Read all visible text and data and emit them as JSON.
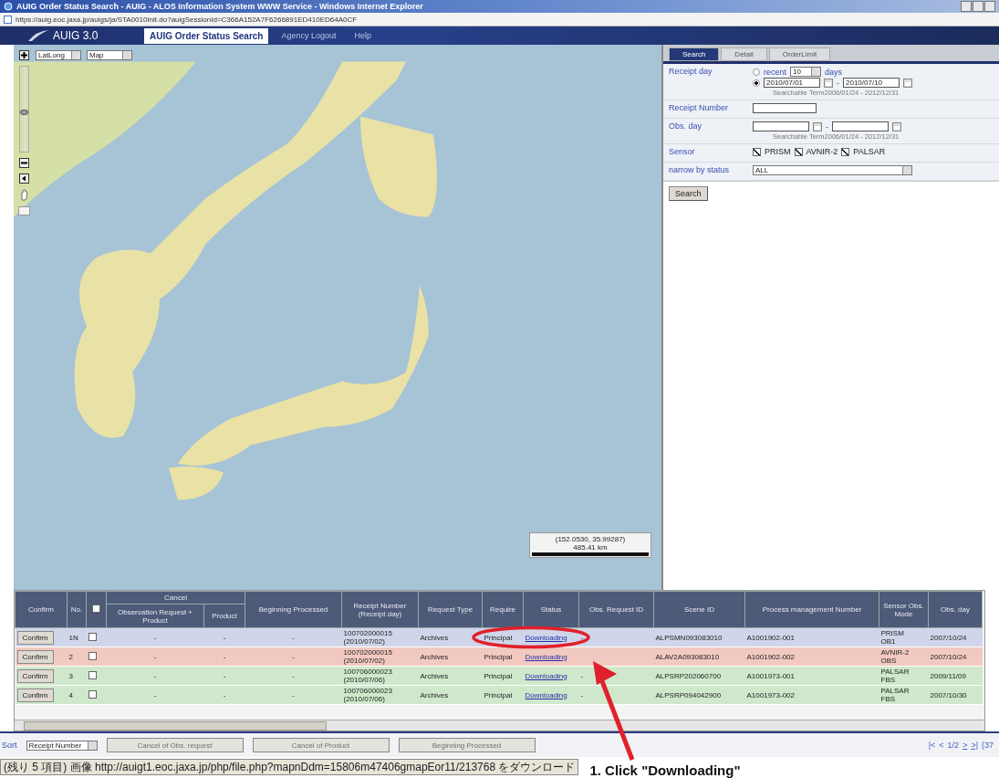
{
  "window": {
    "title": "AUIG Order Status Search - AUIG - ALOS Information System WWW Service - Windows Internet Explorer"
  },
  "address_bar": {
    "url": "https://auig.eoc.jaxa.jp/auigs/ja/STA0010Init.do?auigSessionId=C366A152A7F6266891ED410ED64A0CF"
  },
  "nav": {
    "logo": "AUIG 3.0",
    "tabs": [
      {
        "label": "AUIG Order Status Search",
        "selected": true
      },
      {
        "label": "Agency Logout",
        "selected": false
      },
      {
        "label": "Help",
        "selected": false
      }
    ]
  },
  "map": {
    "zoom": {
      "level": 0.45
    },
    "projection_select": "LatLong",
    "layer_select": "Map",
    "coordinates": "(152.0530, 35.99287)",
    "scale": "485.41 km"
  },
  "search_panel": {
    "tabs": [
      {
        "label": "Search",
        "selected": true
      },
      {
        "label": "Detail",
        "selected": false
      },
      {
        "label": "OrderLimit",
        "selected": false
      }
    ],
    "receipt_day": {
      "label": "Receipt day",
      "recent": {
        "selected": false,
        "label": "recent",
        "value": "10",
        "unit": "days"
      },
      "range": {
        "selected": true,
        "from": "2010/07/01",
        "separator": "-",
        "to": "2010/07/10"
      },
      "note": "Searchable Term2006/01/24 - 2012/12/31"
    },
    "receipt_number": {
      "label": "Receipt Number"
    },
    "obs_day": {
      "label": "Obs. day",
      "separator": "-",
      "note": "Searchable Term2006/01/24 - 2012/12/31"
    },
    "sensor": {
      "label": "Sensor",
      "options": [
        {
          "label": "PRISM",
          "checked": true
        },
        {
          "label": "AVNIR-2",
          "checked": true
        },
        {
          "label": "PALSAR",
          "checked": true
        }
      ]
    },
    "status_filter": {
      "label": "narrow by status",
      "value": "ALL"
    },
    "search_button": "Search"
  },
  "table": {
    "columns": [
      {
        "kind": "text",
        "label": "Confirm"
      },
      {
        "kind": "text",
        "label": "No."
      },
      {
        "kind": "checkbox",
        "checked": false
      },
      {
        "kind": "group",
        "label": "Cancel",
        "children": [
          {
            "label": "Observation Request + Product"
          },
          {
            "label": "Product"
          }
        ]
      },
      {
        "kind": "text",
        "label": "Beginning Processed"
      },
      {
        "kind": "text",
        "label": "Receipt Number (Receipt day)"
      },
      {
        "kind": "text",
        "label": "Request Type"
      },
      {
        "kind": "text",
        "label": "Require"
      },
      {
        "kind": "text",
        "label": "Status"
      },
      {
        "kind": "text",
        "label": "Obs. Request ID"
      },
      {
        "kind": "text",
        "label": "Scene ID"
      },
      {
        "kind": "text",
        "label": "Process management Number"
      },
      {
        "kind": "text",
        "label": "Sensor Obs. Mode"
      },
      {
        "kind": "text",
        "label": "Obs. day"
      }
    ],
    "rows": [
      {
        "confirm": "Confirm",
        "no": "1N",
        "checked": false,
        "cancel_obs": "-",
        "cancel_product": "-",
        "beginning": "-",
        "receipt_number": "100702000015",
        "receipt_day": "(2010/07/02)",
        "request_type": "Archives",
        "require": "Principal",
        "status": "Downloading",
        "obs_request_id": "-",
        "scene_id": "ALPSMN093083010",
        "process_number": "A1001902-001",
        "sensor": "PRISM",
        "obs_mode": "OB1",
        "obs_day": "2007/10/24",
        "color": "#cfd6ea"
      },
      {
        "confirm": "Confirm",
        "no": "2",
        "checked": false,
        "cancel_obs": "-",
        "cancel_product": "-",
        "beginning": "-",
        "receipt_number": "100702000015",
        "receipt_day": "(2010/07/02)",
        "request_type": "Archives",
        "require": "Principal",
        "status": "Downloading",
        "scene_id": "ALAV2A093083010",
        "process_number": "A1001902-002",
        "sensor": "AVNIR-2",
        "obs_mode": "OBS",
        "obs_day": "2007/10/24",
        "color": "#f2c9c0"
      },
      {
        "confirm": "Confirm",
        "no": "3",
        "checked": false,
        "cancel_obs": "-",
        "cancel_product": "-",
        "beginning": "-",
        "receipt_number": "100706000023",
        "receipt_day": "(2010/07/06)",
        "request_type": "Archives",
        "require": "Principal",
        "status": "Downloading",
        "obs_request_id": "-",
        "scene_id": "ALPSRP202060700",
        "process_number": "A1001973-001",
        "sensor": "PALSAR",
        "obs_mode": "FBS",
        "obs_day": "2009/11/09",
        "color": "#cfe8cc"
      },
      {
        "confirm": "Confirm",
        "no": "4",
        "checked": false,
        "cancel_obs": "-",
        "cancel_product": "-",
        "beginning": "-",
        "receipt_number": "100706000023",
        "receipt_day": "(2010/07/06)",
        "request_type": "Archives",
        "require": "Principal",
        "status": "Downloading",
        "obs_request_id": "-",
        "scene_id": "ALPSRP094042900",
        "process_number": "A1001973-002",
        "sensor": "PALSAR",
        "obs_mode": "FBS",
        "obs_day": "2007/10/30",
        "color": "#cfe8cc"
      }
    ]
  },
  "bottom_bar": {
    "sort_label": "Sort",
    "sort_value": "Receipt Number",
    "buttons": [
      {
        "label": "Cancel of Obs. request",
        "disabled": true
      },
      {
        "label": "Cancel of Product",
        "disabled": true
      },
      {
        "label": "Beginning Processed",
        "disabled": true
      }
    ],
    "pager": {
      "first": "|<",
      "prev": "<",
      "page": "1/2",
      "next": ">",
      "last": ">|",
      "count": "(37"
    }
  },
  "status_bar": {
    "text": "(残り 5 項目) 画像 http://auigt1.eoc.jaxa.jp/php/file.php?mapnDdm=15806m47406gmapEor11/213768 をダウンロード"
  },
  "annotation": {
    "caption": "1. Click \"Downloading\""
  }
}
